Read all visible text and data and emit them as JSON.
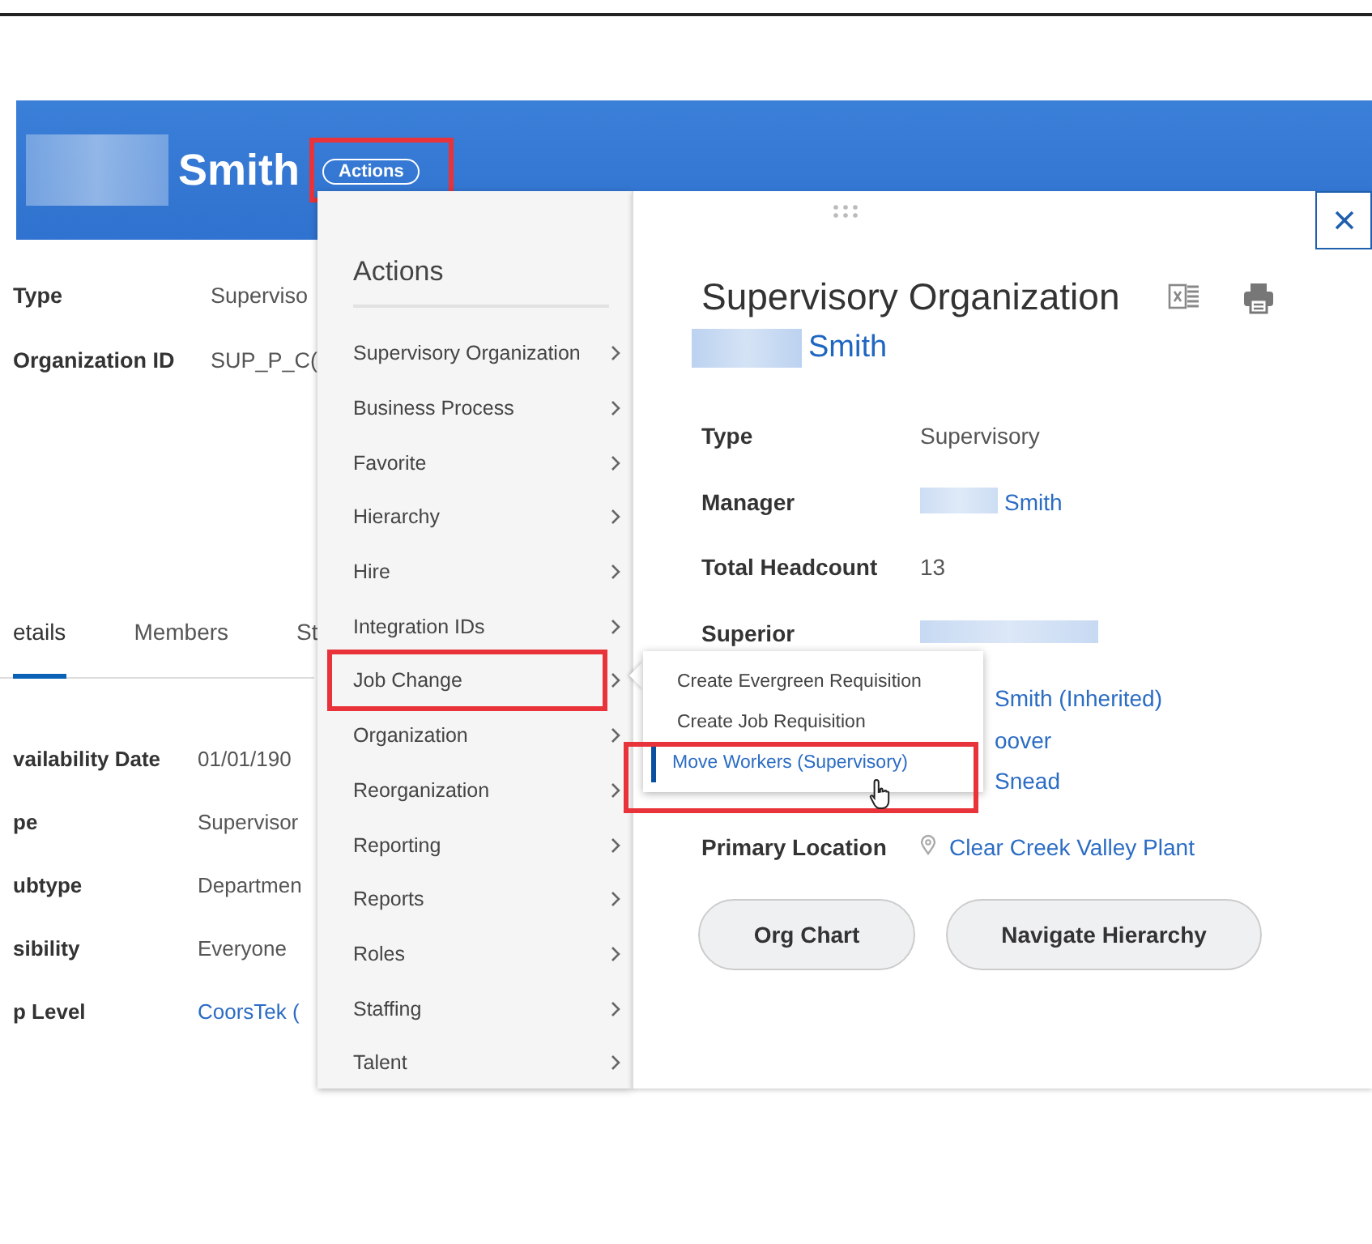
{
  "page": {
    "name": "Smith",
    "actions_button": {
      "label": "Actions",
      "annotated": true
    },
    "fields": [
      {
        "label": "Type",
        "value": "Superviso"
      },
      {
        "label": "Organization ID",
        "value": "SUP_P_C("
      }
    ],
    "tabs": [
      {
        "label": "etails",
        "selected": true
      },
      {
        "label": "Members",
        "selected": false
      },
      {
        "label": "St",
        "selected": false
      }
    ],
    "details": [
      {
        "label": "vailability Date",
        "value": "01/01/190",
        "kind": "text"
      },
      {
        "label": "pe",
        "value": "Supervisor",
        "kind": "text"
      },
      {
        "label": "ubtype",
        "value": "Departmen",
        "kind": "text"
      },
      {
        "label": "sibility",
        "value": "Everyone",
        "kind": "text"
      },
      {
        "label": "p Level",
        "value": "CoorsTek (",
        "kind": "link"
      }
    ]
  },
  "actions_menu": {
    "title": "Actions",
    "items": [
      {
        "label": "Supervisory Organization",
        "annotated": false
      },
      {
        "label": "Business Process",
        "annotated": false
      },
      {
        "label": "Favorite",
        "annotated": false
      },
      {
        "label": "Hierarchy",
        "annotated": false
      },
      {
        "label": "Hire",
        "annotated": false
      },
      {
        "label": "Integration IDs",
        "annotated": false
      },
      {
        "label": "Job Change",
        "annotated": true
      },
      {
        "label": "Organization",
        "annotated": false
      },
      {
        "label": "Reorganization",
        "annotated": false
      },
      {
        "label": "Reporting",
        "annotated": false
      },
      {
        "label": "Reports",
        "annotated": false
      },
      {
        "label": "Roles",
        "annotated": false
      },
      {
        "label": "Staffing",
        "annotated": false
      },
      {
        "label": "Talent",
        "annotated": false
      }
    ]
  },
  "submenu": {
    "items": [
      {
        "label": "Create Evergreen Requisition",
        "selected": false,
        "annotated": false
      },
      {
        "label": "Create Job Requisition",
        "selected": false,
        "annotated": false
      },
      {
        "label": "Move Workers (Supervisory)",
        "selected": true,
        "annotated": true
      }
    ]
  },
  "panel": {
    "title": "Supervisory Organization",
    "subtitle": "Smith",
    "fields": [
      {
        "kind": "text",
        "label": "Type",
        "value": "Supervisory"
      },
      {
        "kind": "person",
        "label": "Manager",
        "value": "Smith"
      },
      {
        "kind": "text",
        "label": "Total Headcount",
        "value": "13"
      },
      {
        "kind": "redacted",
        "label": "Superior"
      },
      {
        "kind": "link",
        "value": "Smith (Inherited)"
      },
      {
        "kind": "link",
        "value": "oover"
      },
      {
        "kind": "link",
        "value": "Snead"
      },
      {
        "kind": "location",
        "label": "Primary Location",
        "value": "Clear Creek Valley Plant"
      }
    ],
    "buttons": [
      "Org Chart",
      "Navigate Hierarchy"
    ]
  }
}
